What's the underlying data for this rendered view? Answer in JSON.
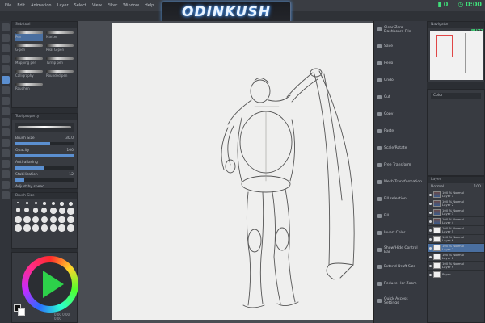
{
  "menu": [
    "File",
    "Edit",
    "Animation",
    "Layer",
    "Select",
    "View",
    "Filter",
    "Window",
    "Help"
  ],
  "logo": {
    "text": "ODINKUSH"
  },
  "stream": {
    "viewers": "0",
    "timer": "0:00"
  },
  "subtool": {
    "title": "Sub tool",
    "brushes": [
      {
        "label": "Pen",
        "selected": true
      },
      {
        "label": "Marker",
        "selected": false
      },
      {
        "label": "G-pen",
        "selected": false
      },
      {
        "label": "Real G-pen",
        "selected": false
      },
      {
        "label": "Mapping pen",
        "selected": false
      },
      {
        "label": "Turnip pen",
        "selected": false
      },
      {
        "label": "Calligraphy",
        "selected": false
      },
      {
        "label": "Rounded pen",
        "selected": false
      },
      {
        "label": "Roughen",
        "selected": false
      }
    ]
  },
  "tool_property": {
    "title": "Tool property",
    "rows": [
      {
        "label": "Brush Size",
        "value": "30.0",
        "level": 0.6
      },
      {
        "label": "Opacity",
        "value": "100",
        "level": 1.0
      },
      {
        "label": "Anti-aliasing",
        "value": "",
        "level": 0.5
      },
      {
        "label": "Stabilization",
        "value": "12",
        "level": 0.15
      }
    ],
    "checkbox": "Adjust by speed"
  },
  "brush_size": {
    "title": "Brush Size"
  },
  "color_panel": {
    "readout": "0.00  0.00  0.00"
  },
  "commands": [
    "Clear Zero Dashboard File",
    "Save",
    "Redo",
    "Undo",
    "Cut",
    "Copy",
    "Paste",
    "Scale/Rotate",
    "Free Transform",
    "Mesh Transformation",
    "Fill selection",
    "Fill",
    "Invert Color",
    "Show/Hide Control Bar",
    "Extend Draft Size",
    "Reduce Hor Zoom",
    "Quick Access Settings"
  ],
  "navigator": {
    "title": "Navigator",
    "badge": "BUZZ"
  },
  "sub_view": {
    "selector": "Color"
  },
  "layers": {
    "title": "Layer",
    "blend": "Normal",
    "opacity": "100",
    "items": [
      {
        "name": "100 % Normal",
        "sub": "Layer 1",
        "selected": false,
        "photo": true
      },
      {
        "name": "100 % Normal",
        "sub": "Layer 2",
        "selected": false,
        "photo": true
      },
      {
        "name": "100 % Normal",
        "sub": "Layer 3",
        "selected": false,
        "photo": true
      },
      {
        "name": "100 % Normal",
        "sub": "Layer 4",
        "selected": false,
        "photo": true
      },
      {
        "name": "100 % Normal",
        "sub": "Layer 5",
        "selected": false,
        "photo": false
      },
      {
        "name": "100 % Normal",
        "sub": "Layer 6",
        "selected": false,
        "photo": false
      },
      {
        "name": "100 % Normal",
        "sub": "Layer 7",
        "selected": true,
        "photo": false
      },
      {
        "name": "100 % Normal",
        "sub": "Layer 8",
        "selected": false,
        "photo": false
      },
      {
        "name": "100 % Normal",
        "sub": "Layer 9",
        "selected": false,
        "photo": false
      },
      {
        "name": "",
        "sub": "Paper",
        "selected": false,
        "photo": false
      }
    ]
  }
}
